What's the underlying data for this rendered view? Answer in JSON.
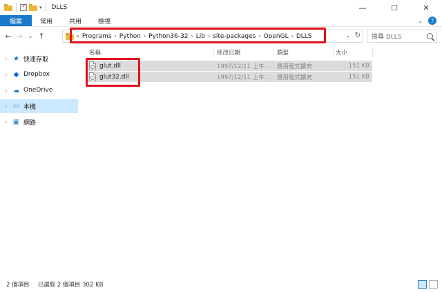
{
  "window": {
    "title": "DLLS",
    "controls": [
      "—",
      "☐",
      "✕"
    ]
  },
  "ribbon": {
    "tabs": [
      {
        "label": "檔案",
        "active": true
      },
      {
        "label": "常用"
      },
      {
        "label": "共用"
      },
      {
        "label": "檢視"
      }
    ]
  },
  "address": {
    "crumbs": [
      "Programs",
      "Python",
      "Python36-32",
      "Lib",
      "site-packages",
      "OpenGL",
      "DLLS"
    ],
    "lead": "«"
  },
  "search": {
    "placeholder": "搜尋 DLLS"
  },
  "nav": {
    "items": [
      {
        "label": "快速存取",
        "icon": "star-icon"
      },
      {
        "label": "Dropbox",
        "icon": "dropbox-icon"
      },
      {
        "label": "OneDrive",
        "icon": "cloud-icon"
      },
      {
        "label": "本機",
        "icon": "computer-icon",
        "selected": true
      },
      {
        "label": "網路",
        "icon": "network-icon"
      }
    ]
  },
  "columns": {
    "name": "名稱",
    "modified": "修改日期",
    "type": "類型",
    "size": "大小"
  },
  "files": [
    {
      "name": "glut.dll",
      "modified": "1997/12/11 上午 ...",
      "type": "應用程式擴充",
      "size": "151 KB"
    },
    {
      "name": "glut32.dll",
      "modified": "1997/12/11 上午 ...",
      "type": "應用程式擴充",
      "size": "151 KB"
    }
  ],
  "status": {
    "count": "2 個項目",
    "selected": "已選取 2 個項目  302 KB"
  },
  "colors": {
    "accent": "#1979ca",
    "highlight_box": "#e0101a",
    "selection": "#cce8ff",
    "selected_row": "#dcdcdc"
  }
}
